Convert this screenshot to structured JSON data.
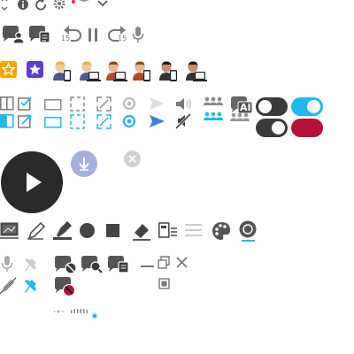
{
  "skip_back_seconds": "15",
  "skip_forward_seconds": "15",
  "ai_badge": "AI",
  "colors": {
    "icon_dark": "#444444",
    "icon_mid": "#888888",
    "icon_light": "#b8b8b8",
    "accent_blue": "#1eb8ef",
    "brand_purple": "#5a3fd0",
    "star_orange": "#f5a300",
    "record_red": "#b5103a",
    "download_blue": "#a4b0dc",
    "play_bg": "#2a2a2a"
  },
  "toggles": {
    "dark_off": false,
    "blue_on": true,
    "dark_on": true,
    "red_on": true
  }
}
